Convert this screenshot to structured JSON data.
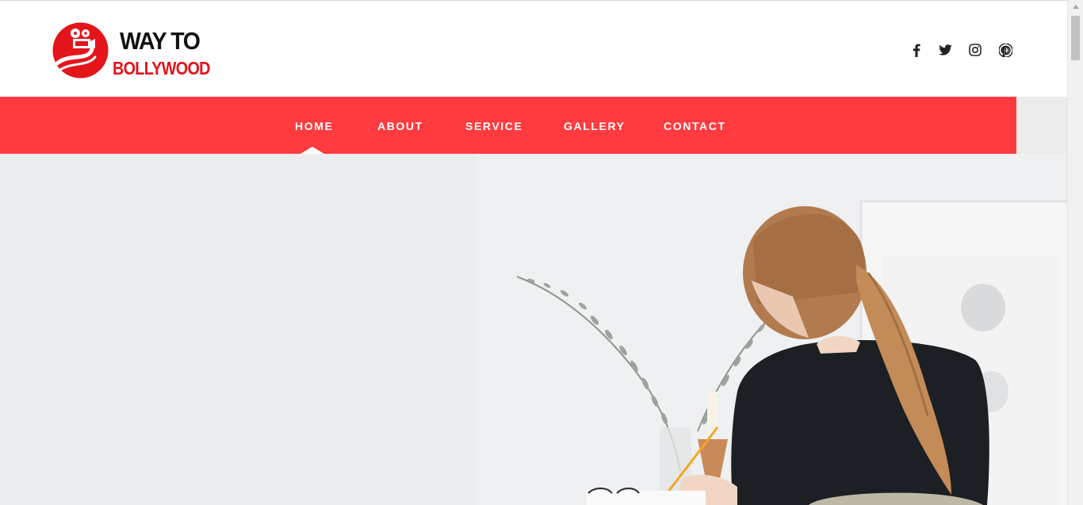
{
  "brand": {
    "line1": "WAY TO",
    "line2": "BOLLYWOOD",
    "primary_color": "#e4141b",
    "text_color": "#111111"
  },
  "social": [
    {
      "name": "facebook-icon",
      "glyph": "f"
    },
    {
      "name": "twitter-icon",
      "glyph": "twitter"
    },
    {
      "name": "instagram-icon",
      "glyph": "instagram"
    },
    {
      "name": "pinterest-icon",
      "glyph": "pinterest"
    }
  ],
  "nav": {
    "background": "#ff3b3f",
    "active": "HOME",
    "items": [
      {
        "label": "HOME"
      },
      {
        "label": "ABOUT"
      },
      {
        "label": "SERVICE"
      },
      {
        "label": "GALLERY"
      },
      {
        "label": "CONTACT"
      }
    ]
  },
  "hero": {
    "image": "woman-writing-at-desk-photo"
  }
}
